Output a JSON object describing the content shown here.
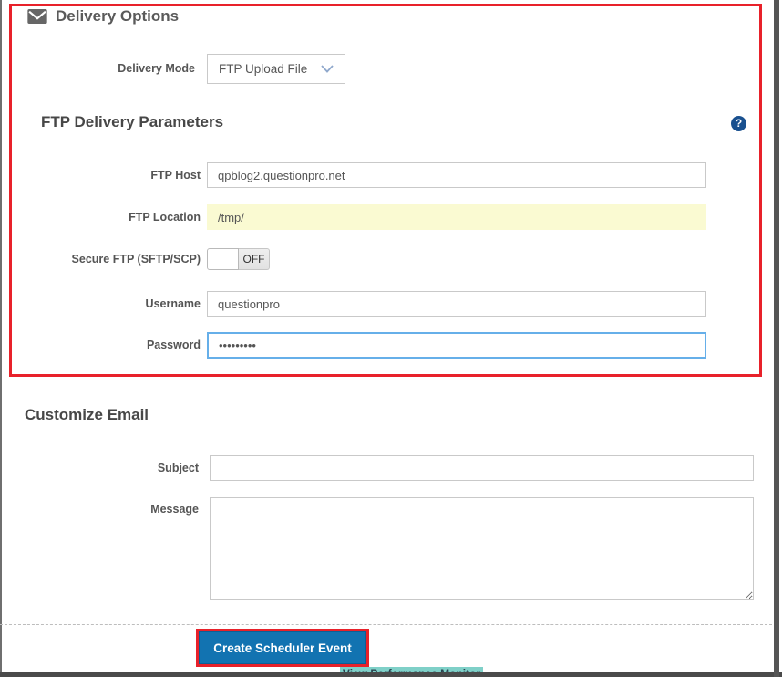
{
  "colors": {
    "annotation_red": "#e8212a",
    "button_blue": "#1273b1",
    "help_blue": "#19508f",
    "location_field_yellow": "#fafad2",
    "focused_input_blue": "#66afe9"
  },
  "delivery_options": {
    "title": "Delivery Options",
    "icon": "envelope-icon",
    "mode_label": "Delivery Mode",
    "mode_value": "FTP Upload File"
  },
  "ftp_parameters": {
    "title": "FTP Delivery Parameters",
    "help_icon_glyph": "?",
    "host_label": "FTP Host",
    "host_value": "qpblog2.questionpro.net",
    "location_label": "FTP Location",
    "location_value": "/tmp/",
    "secure_label": "Secure FTP (SFTP/SCP)",
    "secure_toggle_state": "OFF",
    "username_label": "Username",
    "username_value": "questionpro",
    "password_label": "Password",
    "password_value": "•••••••••"
  },
  "customize_email": {
    "title": "Customize Email",
    "subject_label": "Subject",
    "subject_value": "",
    "message_label": "Message",
    "message_value": ""
  },
  "footer": {
    "create_button_label": "Create Scheduler Event",
    "partial_bottom_text": "View Performance Monitor"
  }
}
